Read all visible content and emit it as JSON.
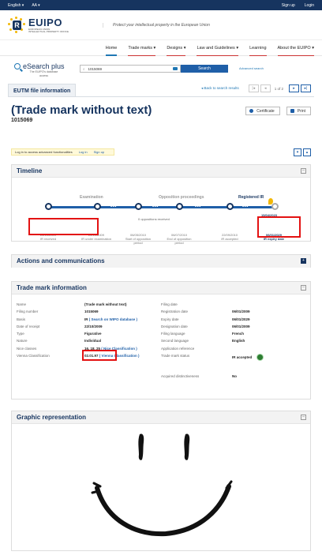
{
  "topbar": {
    "language": "English ▾",
    "font_size": "AA ▾",
    "signup": "Sign up",
    "login": "Login"
  },
  "header": {
    "logo_text": "EUIPO",
    "logo_sub1": "EUROPEAN UNION",
    "logo_sub2": "INTELLECTUAL PROPERTY OFFICE",
    "tagline": "Protect your intellectual property in the European Union"
  },
  "nav": [
    "Home",
    "Trade marks ▾",
    "Designs ▾",
    "Law and Guidelines ▾",
    "Learning",
    "About the EUIPO ▾"
  ],
  "search": {
    "app_title": "eSearch plus",
    "app_sub1": "The EUIPO's database",
    "app_sub2": "access",
    "value": "1015069",
    "button": "Search",
    "advanced": "Advanced search"
  },
  "tab": {
    "label": "EUTM file information"
  },
  "pager": {
    "back": "◂  Back to search results",
    "first": "|◂",
    "prev": "◂",
    "count": "1 of 2",
    "next": "▸",
    "last": "▸|"
  },
  "title": {
    "heading": "(Trade mark without text)",
    "number": "1015069"
  },
  "actions": {
    "certificate": "Certificate",
    "print": "Print"
  },
  "loginbar": {
    "text": "Log in to access advanced functionalities",
    "login": "Log in",
    "signup": "Sign up"
  },
  "expand": {
    "down": "▾",
    "up": "▴"
  },
  "timeline": {
    "title": "Timeline",
    "toggle": "–",
    "stage_examination": "Examination",
    "stage_opposition": "Opposition proceedings",
    "stage_registered": "Registered IR",
    "oppositions": "0 oppositions received",
    "flag_date": "15/04/2023",
    "dots": "•••",
    "dates": [
      {
        "date": "22/10/2009",
        "label": "IR received"
      },
      {
        "date": "22/10/2009",
        "label": "IR under examination"
      },
      {
        "date": "06/05/2010",
        "label": "Start of opposition period"
      },
      {
        "date": "06/07/2010",
        "label": "End of opposition period"
      },
      {
        "date": "22/09/2010",
        "label": "IR accepted"
      },
      {
        "date": "06/01/2029",
        "label": "IR expiry date"
      }
    ]
  },
  "actions_panel": {
    "title": "Actions and communications",
    "toggle": "+"
  },
  "tm_info": {
    "title": "Trade mark information",
    "toggle": "–",
    "left": [
      {
        "k": "Name",
        "v": "(Trade mark without text)"
      },
      {
        "k": "Filing number",
        "v": "1015069"
      },
      {
        "k": "Basis",
        "v": "IR",
        "link": "( Search on WIPO database )"
      },
      {
        "k": "Date of receipt",
        "v": "22/10/2009"
      },
      {
        "k": "Type",
        "v": "Figurative"
      },
      {
        "k": "Nature",
        "v": "Individual"
      },
      {
        "k": "Nice classes",
        "v": "16, 18, 25",
        "link": "( Nice Classification )"
      },
      {
        "k": "Vienna Classification",
        "v": "02.01.97",
        "link": "( Vienna Classification )"
      }
    ],
    "right": [
      {
        "k": "Filing date",
        "v": ""
      },
      {
        "k": "Registration date",
        "v": "06/01/2009"
      },
      {
        "k": "Expiry date",
        "v": "06/01/2029"
      },
      {
        "k": "Designation date",
        "v": "06/01/2009"
      },
      {
        "k": "Filing language",
        "v": "French"
      },
      {
        "k": "Second language",
        "v": "English"
      },
      {
        "k": "Application reference",
        "v": ""
      },
      {
        "k": "Trade mark status",
        "v": "IR accepted"
      },
      {
        "k": "",
        "v": ""
      },
      {
        "k": "Acquired distinctiveness",
        "v": "No"
      }
    ]
  },
  "graphic": {
    "title": "Graphic representation",
    "toggle": "–"
  },
  "colors": {
    "brand": "#16345f",
    "accent": "#1f5fa8",
    "highlight": "#e31212"
  }
}
